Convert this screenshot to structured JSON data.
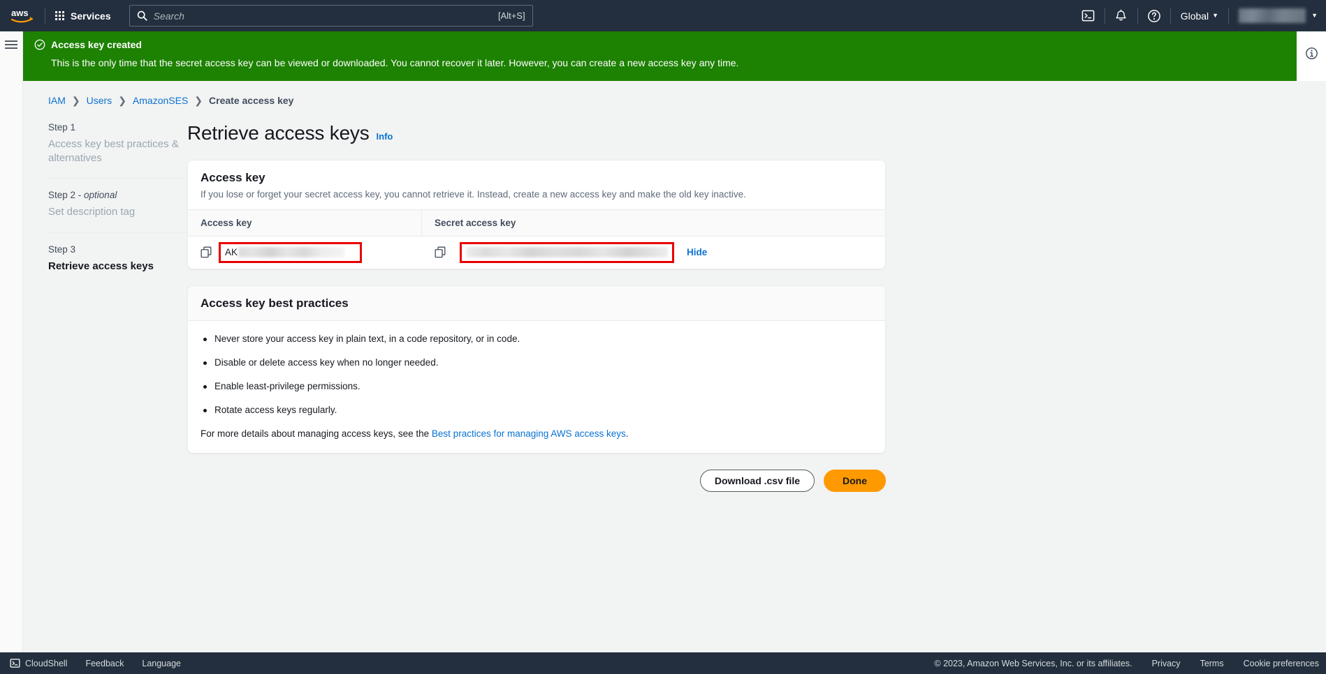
{
  "topnav": {
    "logo_alt": "aws",
    "services_label": "Services",
    "search_placeholder": "Search",
    "search_value": "",
    "search_shortcut": "[Alt+S]",
    "cloudshell_icon": "cloudshell-icon",
    "notifications_icon": "bell-icon",
    "help_icon": "question-circle-icon",
    "region_label": "Global",
    "region_caret": "▼",
    "account_caret": "▼",
    "account_name_masked": ""
  },
  "flash": {
    "status_icon": "success-check-icon",
    "title": "Access key created",
    "message": "This is the only time that the secret access key can be viewed or downloaded. You cannot recover it later. However, you can create a new access key any time.",
    "background_color": "#1d8102"
  },
  "side_panel": {
    "info_icon": "info-circle-icon"
  },
  "breadcrumb": {
    "items": [
      {
        "label": "IAM",
        "link": true
      },
      {
        "label": "Users",
        "link": true
      },
      {
        "label": "AmazonSES",
        "link": true
      },
      {
        "label": "Create access key",
        "link": false
      }
    ],
    "separator": "❯"
  },
  "steps": [
    {
      "step": "Step 1",
      "optional": "",
      "name": "Access key best practices & alternatives",
      "active": false
    },
    {
      "step": "Step 2 - ",
      "optional": "optional",
      "name": "Set description tag",
      "active": false
    },
    {
      "step": "Step 3",
      "optional": "",
      "name": "Retrieve access keys",
      "active": true
    }
  ],
  "page": {
    "title": "Retrieve access keys",
    "info_label": "Info"
  },
  "access_key_card": {
    "title": "Access key",
    "description": "If you lose or forget your secret access key, you cannot retrieve it. Instead, create a new access key and make the old key inactive.",
    "columns": [
      "Access key",
      "Secret access key"
    ],
    "access_key_visible_prefix": "AK",
    "access_key_masked": true,
    "secret_key_masked": true,
    "copy_icon": "copy-icon",
    "hide_label": "Hide",
    "highlight_color": "#e80000"
  },
  "best_practices_card": {
    "title": "Access key best practices",
    "bullets": [
      "Never store your access key in plain text, in a code repository, or in code.",
      "Disable or delete access key when no longer needed.",
      "Enable least-privilege permissions.",
      "Rotate access keys regularly."
    ],
    "note_prefix": "For more details about managing access keys, see the ",
    "note_link": "Best practices for managing AWS access keys",
    "note_suffix": "."
  },
  "actions": {
    "download_label": "Download .csv file",
    "done_label": "Done",
    "primary_color": "#ff9900"
  },
  "footer": {
    "cloudshell_label": "CloudShell",
    "cloudshell_icon": "cloudshell-icon",
    "feedback_label": "Feedback",
    "language_label": "Language",
    "copyright": "© 2023, Amazon Web Services, Inc. or its affiliates.",
    "privacy_label": "Privacy",
    "terms_label": "Terms",
    "cookie_label": "Cookie preferences"
  }
}
